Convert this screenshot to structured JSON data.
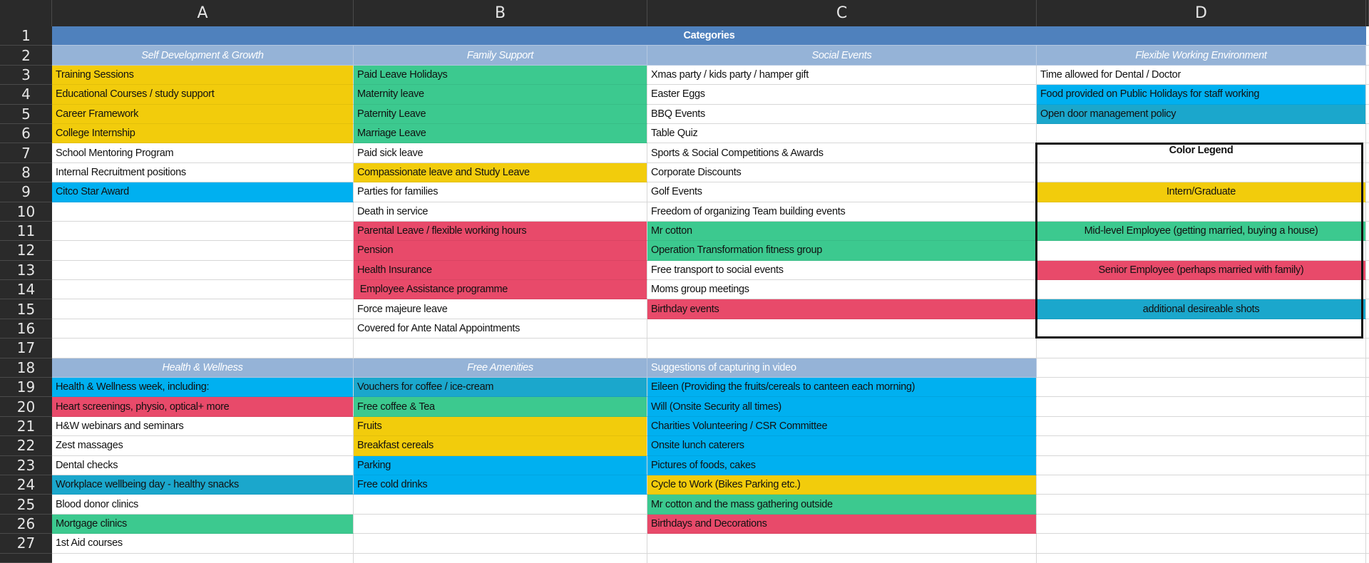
{
  "columns": [
    "A",
    "B",
    "C",
    "D"
  ],
  "rows": [
    "1",
    "2",
    "3",
    "4",
    "5",
    "6",
    "7",
    "8",
    "9",
    "10",
    "11",
    "12",
    "13",
    "14",
    "15",
    "16",
    "17",
    "18",
    "19",
    "20",
    "21",
    "22",
    "23",
    "24",
    "25",
    "26",
    "27"
  ],
  "colors": {
    "title": "#4f81bd",
    "subheader": "#95b3d7",
    "yellow": "#f2cc0c",
    "green": "#3cc98f",
    "blue": "#00b0f0",
    "teal": "#1ba7cc",
    "red": "#e84a6a"
  },
  "cells": [
    [
      {
        "t": "Categories",
        "s": "title",
        "span": 4
      }
    ],
    [
      {
        "t": "Self Development & Growth",
        "s": "sub"
      },
      {
        "t": "Family Support",
        "s": "sub"
      },
      {
        "t": "Social Events",
        "s": "sub"
      },
      {
        "t": "Flexible Working Environment",
        "s": "sub"
      }
    ],
    [
      {
        "t": "Training Sessions",
        "c": "yellow"
      },
      {
        "t": "Paid Leave Holidays",
        "c": "green"
      },
      {
        "t": "Xmas party / kids party / hamper gift"
      },
      {
        "t": "Time allowed for Dental / Doctor"
      }
    ],
    [
      {
        "t": "Educational Courses / study support",
        "c": "yellow"
      },
      {
        "t": "Maternity leave",
        "c": "green"
      },
      {
        "t": "Easter Eggs"
      },
      {
        "t": "Food provided on Public Holidays for staff working",
        "c": "blue"
      }
    ],
    [
      {
        "t": "Career Framework",
        "c": "yellow"
      },
      {
        "t": "Paternity Leave",
        "c": "green"
      },
      {
        "t": "BBQ Events"
      },
      {
        "t": "Open door management policy",
        "c": "teal"
      }
    ],
    [
      {
        "t": "College Internship",
        "c": "yellow"
      },
      {
        "t": "Marriage Leave",
        "c": "green"
      },
      {
        "t": "Table Quiz"
      },
      {
        "t": ""
      }
    ],
    [
      {
        "t": "School Mentoring Program"
      },
      {
        "t": "Paid sick leave"
      },
      {
        "t": "Sports & Social Competitions & Awards"
      },
      {
        "t": "Color Legend",
        "s": "legendtitle"
      }
    ],
    [
      {
        "t": "Internal Recruitment positions"
      },
      {
        "t": "Compassionate leave and Study Leave",
        "c": "yellow"
      },
      {
        "t": "Corporate Discounts"
      },
      {
        "t": ""
      }
    ],
    [
      {
        "t": "Citco Star Award",
        "c": "blue"
      },
      {
        "t": "Parties for families"
      },
      {
        "t": "Golf Events"
      },
      {
        "t": "Intern/Graduate",
        "c": "yellow",
        "s": "center"
      }
    ],
    [
      {
        "t": ""
      },
      {
        "t": "Death in service"
      },
      {
        "t": "Freedom of organizing Team building events"
      },
      {
        "t": ""
      }
    ],
    [
      {
        "t": ""
      },
      {
        "t": "Parental Leave / flexible working hours",
        "c": "red"
      },
      {
        "t": "Mr cotton",
        "c": "green"
      },
      {
        "t": "Mid-level Employee (getting married, buying a house)",
        "c": "green",
        "s": "center"
      }
    ],
    [
      {
        "t": ""
      },
      {
        "t": "Pension",
        "c": "red"
      },
      {
        "t": "Operation Transformation fitness group",
        "c": "green"
      },
      {
        "t": ""
      }
    ],
    [
      {
        "t": ""
      },
      {
        "t": "Health Insurance",
        "c": "red"
      },
      {
        "t": "Free transport to social events"
      },
      {
        "t": "Senior Employee (perhaps married with family)",
        "c": "red",
        "s": "center"
      }
    ],
    [
      {
        "t": ""
      },
      {
        "t": " Employee Assistance programme",
        "c": "red"
      },
      {
        "t": "Moms group meetings"
      },
      {
        "t": ""
      }
    ],
    [
      {
        "t": ""
      },
      {
        "t": "Force majeure leave"
      },
      {
        "t": "Birthday events",
        "c": "red"
      },
      {
        "t": "additional desireable shots",
        "c": "teal",
        "s": "center"
      }
    ],
    [
      {
        "t": ""
      },
      {
        "t": "Covered for Ante Natal Appointments"
      },
      {
        "t": ""
      },
      {
        "t": ""
      }
    ],
    [
      {
        "t": ""
      },
      {
        "t": ""
      },
      {
        "t": ""
      },
      {
        "t": ""
      }
    ],
    [
      {
        "t": "Health & Wellness",
        "s": "sub"
      },
      {
        "t": "Free Amenities",
        "s": "sub"
      },
      {
        "t": "Suggestions of capturing in video",
        "s": "subleft"
      },
      {
        "t": ""
      }
    ],
    [
      {
        "t": "Health & Wellness week, including:",
        "c": "blue"
      },
      {
        "t": "Vouchers for coffee / ice-cream",
        "c": "teal"
      },
      {
        "t": "Eileen (Providing the fruits/cereals to canteen each morning)",
        "c": "blue"
      },
      {
        "t": ""
      }
    ],
    [
      {
        "t": "Heart screenings, physio, optical+ more",
        "c": "red"
      },
      {
        "t": "Free coffee & Tea",
        "c": "green"
      },
      {
        "t": "Will (Onsite Security all times)",
        "c": "blue"
      },
      {
        "t": ""
      }
    ],
    [
      {
        "t": "H&W webinars and seminars"
      },
      {
        "t": "Fruits",
        "c": "yellow"
      },
      {
        "t": "Charities Volunteering / CSR Committee",
        "c": "blue"
      },
      {
        "t": ""
      }
    ],
    [
      {
        "t": "Zest massages"
      },
      {
        "t": "Breakfast cereals",
        "c": "yellow"
      },
      {
        "t": "Onsite lunch caterers",
        "c": "blue"
      },
      {
        "t": ""
      }
    ],
    [
      {
        "t": "Dental checks"
      },
      {
        "t": "Parking",
        "c": "blue"
      },
      {
        "t": "Pictures of foods, cakes",
        "c": "blue"
      },
      {
        "t": ""
      }
    ],
    [
      {
        "t": "Workplace wellbeing day - healthy snacks",
        "c": "teal"
      },
      {
        "t": "Free cold drinks",
        "c": "blue"
      },
      {
        "t": "Cycle to Work (Bikes Parking etc.)",
        "c": "yellow"
      },
      {
        "t": ""
      }
    ],
    [
      {
        "t": "Blood donor clinics"
      },
      {
        "t": ""
      },
      {
        "t": "Mr cotton and the mass gathering outside",
        "c": "green"
      },
      {
        "t": ""
      }
    ],
    [
      {
        "t": "Mortgage clinics",
        "c": "green"
      },
      {
        "t": ""
      },
      {
        "t": "Birthdays and Decorations",
        "c": "red"
      },
      {
        "t": ""
      }
    ],
    [
      {
        "t": "1st Aid courses"
      },
      {
        "t": ""
      },
      {
        "t": ""
      },
      {
        "t": ""
      }
    ]
  ]
}
